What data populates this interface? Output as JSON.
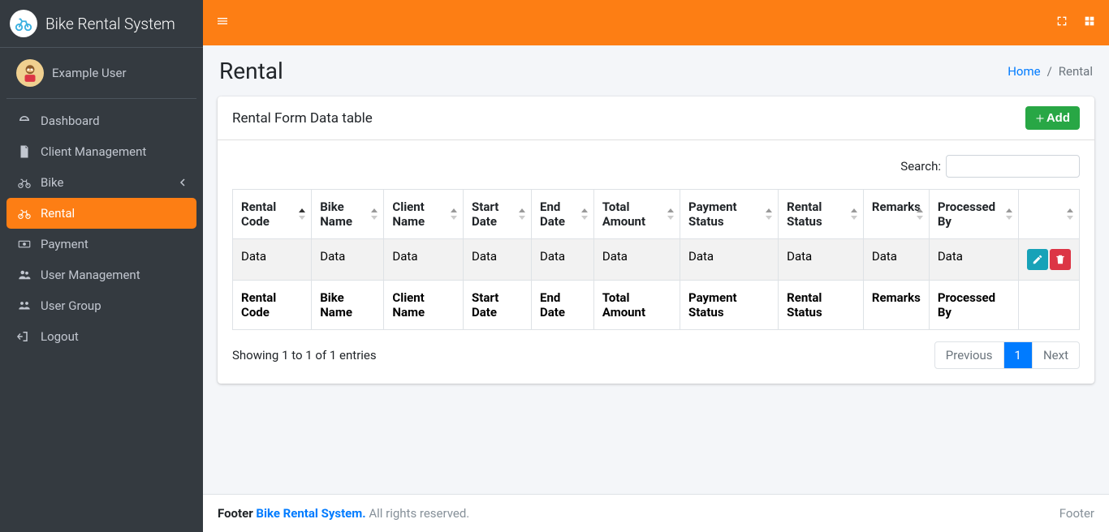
{
  "brand": {
    "title": "Bike Rental System"
  },
  "user": {
    "name": "Example User"
  },
  "sidebar": {
    "items": [
      {
        "label": "Dashboard"
      },
      {
        "label": "Client Management"
      },
      {
        "label": "Bike"
      },
      {
        "label": "Rental"
      },
      {
        "label": "Payment"
      },
      {
        "label": "User Management"
      },
      {
        "label": "User Group"
      },
      {
        "label": "Logout"
      }
    ]
  },
  "header": {
    "title": "Rental",
    "breadcrumb": {
      "home": "Home",
      "current": "Rental"
    }
  },
  "card": {
    "title": "Rental Form Data table",
    "add_label": "Add"
  },
  "search": {
    "label": "Search:",
    "value": ""
  },
  "table": {
    "columns": [
      "Rental Code",
      "Bike Name",
      "Client Name",
      "Start Date",
      "End Date",
      "Total Amount",
      "Payment Status",
      "Rental Status",
      "Remarks",
      "Processed By"
    ],
    "rows": [
      {
        "cells": [
          "Data",
          "Data",
          "Data",
          "Data",
          "Data",
          "Data",
          "Data",
          "Data",
          "Data",
          "Data"
        ]
      }
    ],
    "info": "Showing 1 to 1 of 1 entries"
  },
  "pagination": {
    "previous": "Previous",
    "page": "1",
    "next": "Next"
  },
  "footer": {
    "left_prefix": "Footer ",
    "brand": "Bike Rental System.",
    "rights": " All rights reserved.",
    "right": "Footer"
  }
}
